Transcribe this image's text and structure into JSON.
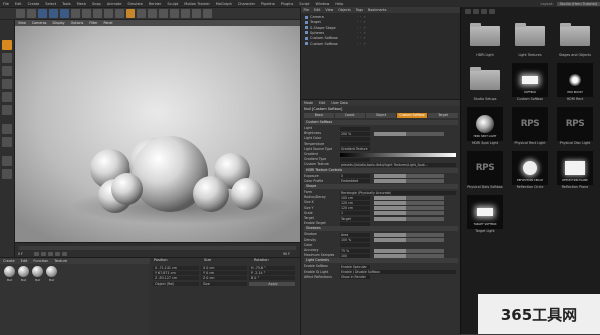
{
  "menubar": {
    "items": [
      "File",
      "Edit",
      "Create",
      "Select",
      "Tools",
      "Mesh",
      "Snap",
      "Animate",
      "Simulate",
      "Render",
      "Sculpt",
      "Motion Tracker",
      "MoGraph",
      "Character",
      "Pipeline",
      "Plugins",
      "Script",
      "Window",
      "Help"
    ],
    "layout_label": "Layout:",
    "layout_value": "Studio (Heru Tutorial)"
  },
  "viewport": {
    "menu": [
      "View",
      "Cameras",
      "Display",
      "Options",
      "Filter",
      "Panel"
    ]
  },
  "timeline": {
    "start": "0 F",
    "end": "90 F"
  },
  "materials": {
    "menu": [
      "Create",
      "Edit",
      "Function",
      "Texture"
    ],
    "balls": [
      "Mat",
      "Mat",
      "Mat",
      "Mat"
    ]
  },
  "coords": {
    "headers": [
      "Position",
      "Size",
      "Rotation"
    ],
    "rows": [
      [
        "X  -71.141 cm",
        "X  0 cm",
        "H  -75.6 °"
      ],
      [
        "Y  67.871 cm",
        "Y  0 cm",
        "P  -2.14 °"
      ],
      [
        "Z  -83.127 cm",
        "Z  0 cm",
        "B  0 °"
      ]
    ],
    "mode": "Object (Rel)",
    "size_mode": "Size",
    "apply": "Apply"
  },
  "objects": {
    "menu": [
      "File",
      "Edit",
      "View",
      "Objects",
      "Tags",
      "Bookmarks"
    ],
    "rows": [
      "Camera",
      "Target",
      "S-Shape Stage",
      "Spheres",
      "Custom Softbox",
      "Custom Softbox"
    ]
  },
  "attributes": {
    "menu": [
      "Mode",
      "Edit",
      "User Data"
    ],
    "title": "Null [Custom Softbox]",
    "tabs": [
      "Basic",
      "Coord.",
      "Object",
      "Custom Softbox",
      "Target"
    ],
    "section1": "Custom Softbox",
    "rows1": [
      {
        "label": "Light",
        "value": ""
      },
      {
        "label": "Brightness",
        "value": "200 %"
      },
      {
        "label": "Light Color",
        "value": ""
      },
      {
        "label": "Temperature",
        "value": ""
      },
      {
        "label": "Light Source Type",
        "value": "Gradient Texture"
      },
      {
        "label": "Gradient",
        "value": ""
      },
      {
        "label": "Gradient Type",
        "value": ""
      },
      {
        "label": "Custom Texture",
        "value": "presets://studio-tools.lib4d/Light Textures/Light_Spot..."
      }
    ],
    "section2": "HDRI Texture Controls",
    "rows2": [
      {
        "label": "Exposure",
        "value": "0"
      },
      {
        "label": "Color Profile",
        "value": "Embedded"
      }
    ],
    "section3": "Shape",
    "rows3": [
      {
        "label": "Form",
        "value": "Rectangle (Physically Accurate)"
      },
      {
        "label": "Radius/Decay",
        "value": "100 cm"
      },
      {
        "label": "Size X",
        "value": "120 cm"
      },
      {
        "label": "Size Y",
        "value": "120 cm"
      },
      {
        "label": "Scale",
        "value": "1"
      },
      {
        "label": "Target",
        "value": "Target"
      },
      {
        "label": "Enable Target",
        "value": ""
      }
    ],
    "section4": "Shadows",
    "rows4": [
      {
        "label": "Shadow",
        "value": "Area"
      },
      {
        "label": "Density",
        "value": "100 %"
      },
      {
        "label": "Color",
        "value": ""
      },
      {
        "label": "Accuracy",
        "value": "75 %"
      },
      {
        "label": "Maximum Samples",
        "value": "100"
      }
    ],
    "section5": "Light Controls",
    "rows5": [
      {
        "label": "Enable Softbox",
        "value": "Enable Specular"
      },
      {
        "label": "Enable GI Light",
        "value": "Enable / Disable Softbox"
      },
      {
        "label": "Affect Reflections",
        "value": "Show in Render"
      }
    ]
  },
  "browser": {
    "tiles": [
      {
        "caption": "HDRI Light",
        "kind": "folder"
      },
      {
        "caption": "Light Textures",
        "kind": "folder"
      },
      {
        "caption": "Stages and Objects",
        "kind": "folder"
      },
      {
        "caption": "Studio Setups",
        "kind": "folder"
      },
      {
        "caption": "Custom Softbox",
        "kind": "softbox",
        "tag": "SOFTBOX"
      },
      {
        "caption": "HDRI Rect",
        "kind": "glow",
        "tag": "HDR BOOST"
      },
      {
        "caption": "HDRI Spot Light",
        "kind": "lens",
        "tag": "HDRI SPOT LIGHT"
      },
      {
        "caption": "Physical Rect Light",
        "kind": "rps",
        "tag": "RPS"
      },
      {
        "caption": "Physical Disc Light",
        "kind": "rps",
        "tag": "RPS"
      },
      {
        "caption": "Physical Dots Softbox",
        "kind": "rps",
        "tag": "RPS"
      },
      {
        "caption": "Reflection Circle",
        "kind": "disc",
        "tag": "REFLECTION CIRCLE"
      },
      {
        "caption": "Reflection Plane",
        "kind": "vert",
        "tag": "REFLECTION PLANE"
      },
      {
        "caption": "Target Light",
        "kind": "softbox",
        "tag": "TARGET SOFTBOX"
      }
    ]
  },
  "watermark": {
    "text": "365工具网"
  },
  "colors": {
    "accent": "#d88a1f",
    "panel": "#303030",
    "browser": "#1c1c1c"
  }
}
